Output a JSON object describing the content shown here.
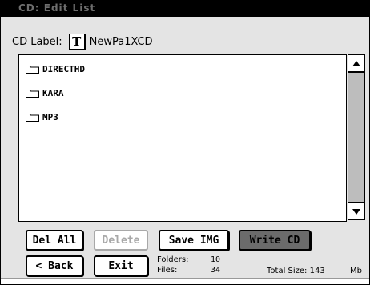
{
  "window": {
    "title": "CD: Edit List"
  },
  "cd_label": {
    "label": "CD Label:",
    "t_button": "T",
    "value": "NewPa1XCD"
  },
  "file_list": {
    "items": [
      {
        "name": "DIRECTHD",
        "icon": "folder-icon"
      },
      {
        "name": "KARA",
        "icon": "folder-icon"
      },
      {
        "name": "MP3",
        "icon": "folder-icon"
      }
    ]
  },
  "buttons": {
    "del_all": "Del All",
    "delete": "Delete",
    "save_img": "Save IMG",
    "write_cd": "Write CD",
    "back": "< Back",
    "exit": "Exit"
  },
  "info": {
    "folders_label": "Folders:",
    "folders_value": "10",
    "files_label": "Files:",
    "files_value": "34",
    "total_size_label": "Total Size: 143",
    "total_size_unit": "Mb"
  },
  "colors": {
    "title_bar": "#000000",
    "panel_bg": "#e4e4e4",
    "write_cd_bg": "#6b6b6b",
    "disabled": "#a8a8a8"
  }
}
